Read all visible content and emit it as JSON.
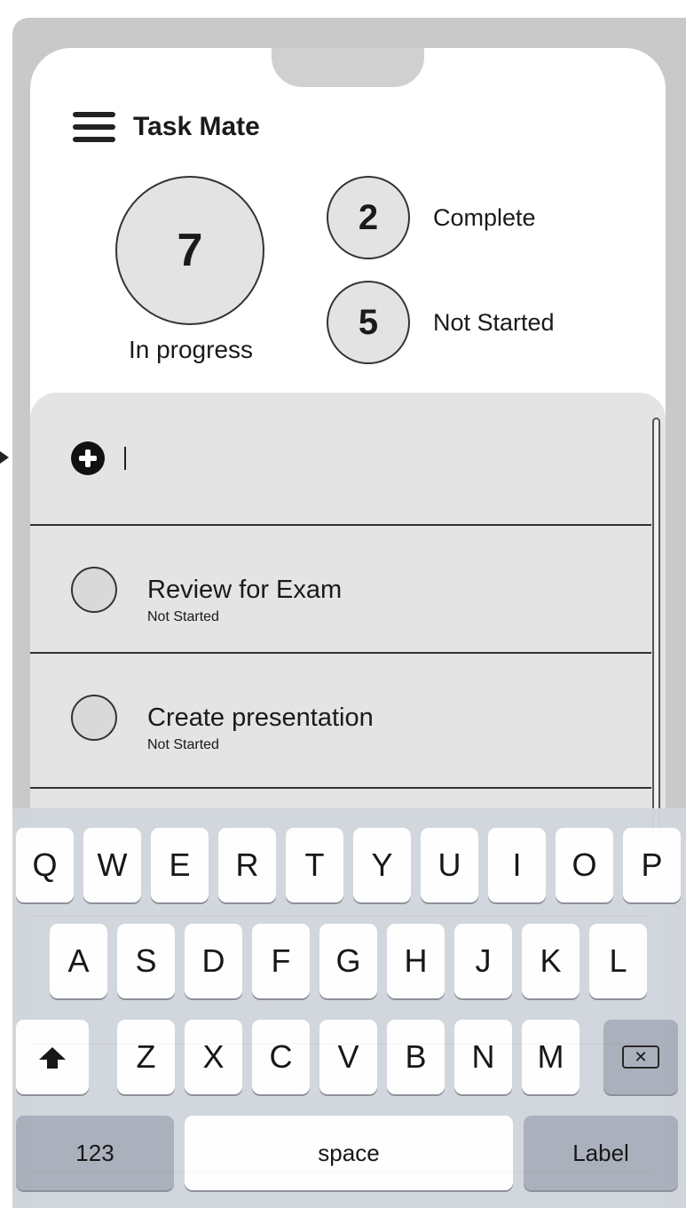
{
  "app": {
    "title": "Task Mate"
  },
  "summary": {
    "in_progress": {
      "count": "7",
      "label": "In progress"
    },
    "complete": {
      "count": "2",
      "label": "Complete"
    },
    "not_started": {
      "count": "5",
      "label": "Not Started"
    }
  },
  "new_task": {
    "value": "",
    "placeholder": ""
  },
  "tasks": [
    {
      "name": "Review for Exam",
      "status": "Not Started"
    },
    {
      "name": "Create presentation",
      "status": "Not Started"
    }
  ],
  "keyboard": {
    "row1": [
      "Q",
      "W",
      "E",
      "R",
      "T",
      "Y",
      "U",
      "I",
      "O",
      "P"
    ],
    "row2": [
      "A",
      "S",
      "D",
      "F",
      "G",
      "H",
      "J",
      "K",
      "L"
    ],
    "row3": [
      "Z",
      "X",
      "C",
      "V",
      "B",
      "N",
      "M"
    ],
    "numbers_label": "123",
    "space_label": "space",
    "return_label": "Label"
  },
  "icons": {
    "menu": "hamburger-menu-icon",
    "add": "plus-circle-icon",
    "shift": "shift-arrow-icon",
    "delete": "backspace-icon"
  },
  "colors": {
    "frame": "#c9c9c9",
    "list_background": "#e4e4e4",
    "circle_fill": "#e3e3e3",
    "keyboard_background": "#d2d6dd",
    "key_dark": "#aab0bb"
  }
}
